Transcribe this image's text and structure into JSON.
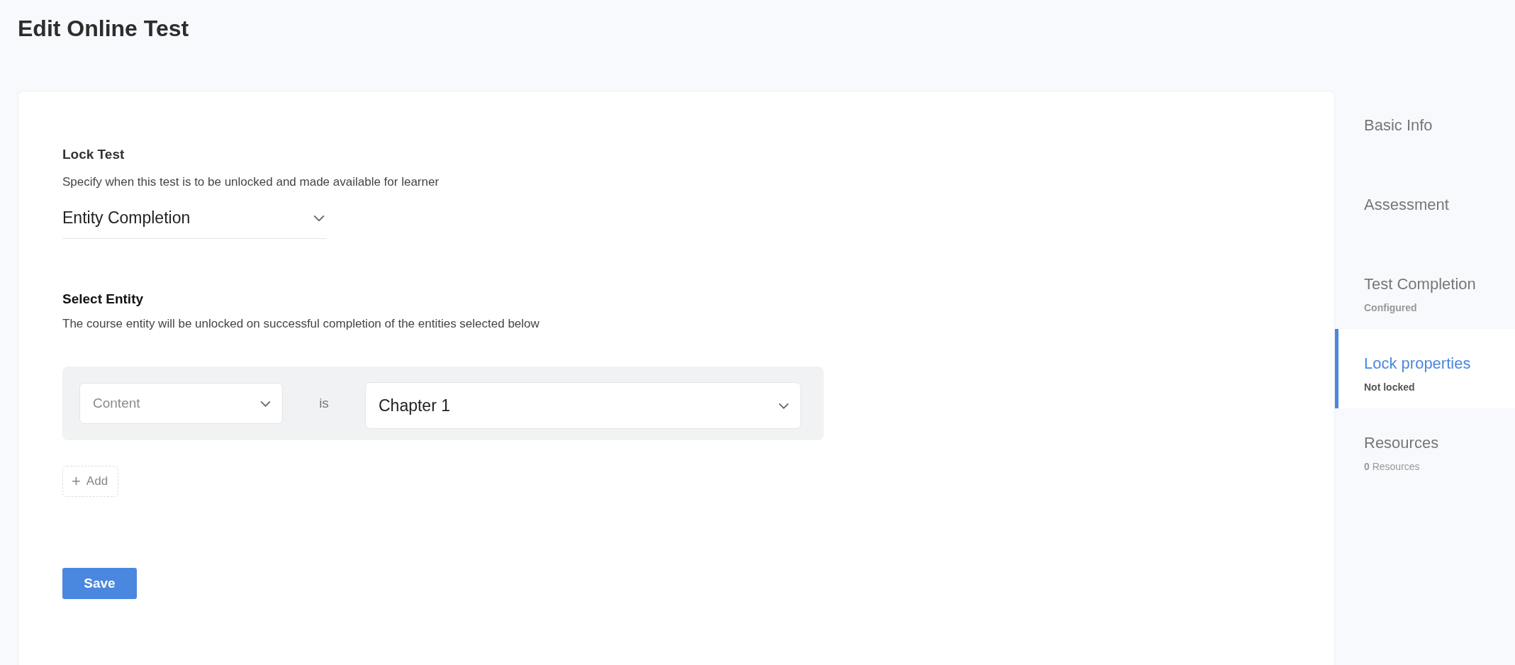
{
  "page": {
    "title": "Edit Online Test"
  },
  "lock_test": {
    "label": "Lock Test",
    "description": "Specify when this test is to be unlocked and made available for learner",
    "dropdown": {
      "value": "Entity Completion"
    }
  },
  "select_entity": {
    "label": "Select Entity",
    "description": "The course entity will be unlocked on successful completion of the entities selected below",
    "condition": {
      "type_select": {
        "placeholder": "Content"
      },
      "operator": "is",
      "entity_select": {
        "value": "Chapter 1"
      }
    },
    "add_button": {
      "icon": "+",
      "label": "Add"
    }
  },
  "save_button": {
    "label": "Save"
  },
  "sidebar": {
    "items": [
      {
        "title": "Basic Info",
        "selected": false
      },
      {
        "title": "Assessment",
        "selected": false
      },
      {
        "title": "Test Completion",
        "subtitle": "Configured",
        "selected": false
      },
      {
        "title": "Lock properties",
        "subtitle": "Not locked",
        "selected": true
      },
      {
        "title": "Resources",
        "subtitle": "**0** Resources",
        "selected": false
      }
    ]
  }
}
